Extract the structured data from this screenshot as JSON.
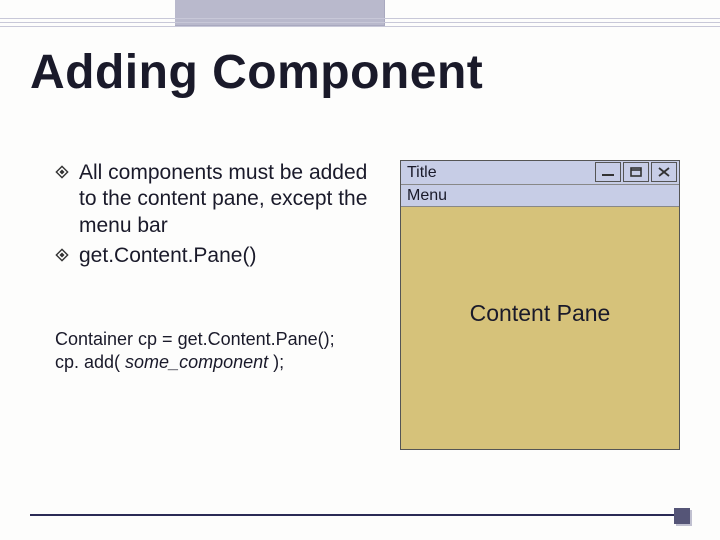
{
  "slide": {
    "title": "Adding Component"
  },
  "bullets": [
    "All components must be added to the content pane, except the menu bar",
    "get.Content.Pane()"
  ],
  "code": {
    "line1": "Container cp = get.Content.Pane();",
    "line2_prefix": "cp. add( ",
    "line2_em": "some_component",
    "line2_suffix": " );"
  },
  "window": {
    "title": "Title",
    "menu": "Menu",
    "content_label": "Content Pane"
  },
  "icons": {
    "minimize": "minimize-icon",
    "maximize": "maximize-icon",
    "close": "close-icon",
    "bullet": "diamond-icon"
  }
}
